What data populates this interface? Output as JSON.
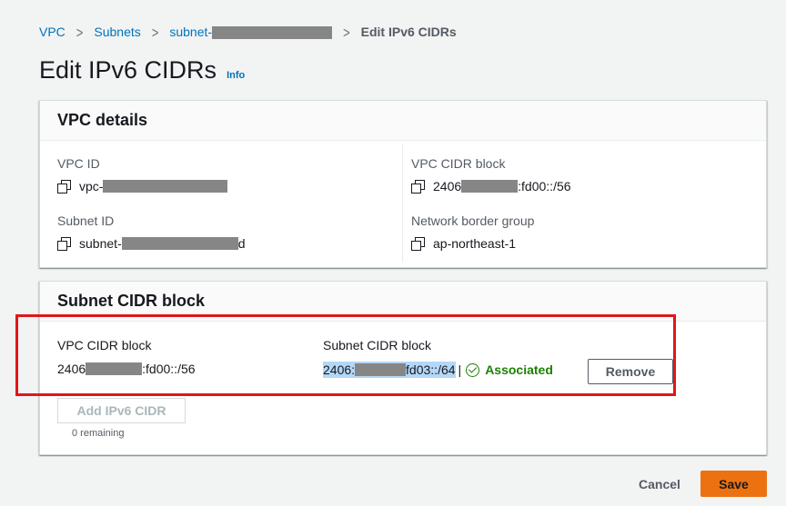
{
  "breadcrumb": {
    "vpc": "VPC",
    "subnets": "Subnets",
    "subnet_prefix": "subnet-",
    "current": "Edit IPv6 CIDRs"
  },
  "page": {
    "title": "Edit IPv6 CIDRs",
    "info": "Info"
  },
  "vpc_details": {
    "header": "VPC details",
    "vpc_id_label": "VPC ID",
    "vpc_id_value": "vpc-",
    "subnet_id_label": "Subnet ID",
    "subnet_id_value": "subnet-",
    "subnet_id_suffix": "d",
    "vpc_cidr_label": "VPC CIDR block",
    "vpc_cidr_prefix": "2406",
    "vpc_cidr_suffix": ":fd00::/56",
    "border_group_label": "Network border group",
    "border_group_value": "ap-northeast-1"
  },
  "subnet_cidr": {
    "header": "Subnet CIDR block",
    "vpc_cidr_label": "VPC CIDR block",
    "vpc_cidr_prefix": "2406",
    "vpc_cidr_suffix": ":fd00::/56",
    "subnet_cidr_label": "Subnet CIDR block",
    "subnet_cidr_prefix": "2406:",
    "subnet_cidr_suffix": "fd03::/64",
    "separator": "|",
    "status": "Associated",
    "remove_label": "Remove",
    "add_label": "Add IPv6 CIDR",
    "remaining": "0 remaining"
  },
  "actions": {
    "cancel": "Cancel",
    "save": "Save"
  },
  "colors": {
    "link": "#0073bb",
    "primary_button": "#ec7211",
    "success": "#1d8102",
    "annotation_box": "#e0161b"
  }
}
